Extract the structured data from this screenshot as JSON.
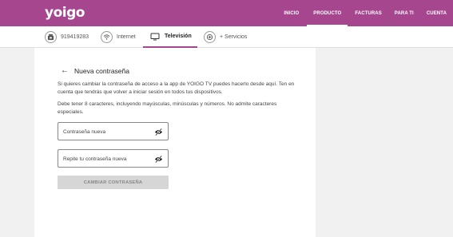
{
  "brand": {
    "logo": "yoigo",
    "color": "#a6468f"
  },
  "nav": {
    "items": [
      "INICIO",
      "PRODUCTO",
      "FACTURAS",
      "PARA TI",
      "CUENTA"
    ],
    "active": "PRODUCTO"
  },
  "services": {
    "phone": "919419283",
    "internet": "Internet",
    "tv": "Televisión",
    "more": "+ Servicios",
    "active": "Televisión"
  },
  "form": {
    "back_icon": "arrow-left-icon",
    "title": "Nueva contraseña",
    "desc1": "Si quieres cambiar la contraseña de acceso a la app de YOIGO TV puedes hacerlo desde aquí. Ten en cuenta que tendrás que volver a iniciar sesión en todos tus dispositivos.",
    "desc2": "Debe tener 8 caracteres, incluyendo mayúsculas, minúsculas y números. No admite caracteres especiales.",
    "new_password": {
      "placeholder": "Contraseña nueva",
      "value": ""
    },
    "repeat_password": {
      "placeholder": "Repite tu contraseña nueva",
      "value": ""
    },
    "submit_label": "CAMBIAR CONTRASEÑA",
    "submit_disabled": true
  }
}
